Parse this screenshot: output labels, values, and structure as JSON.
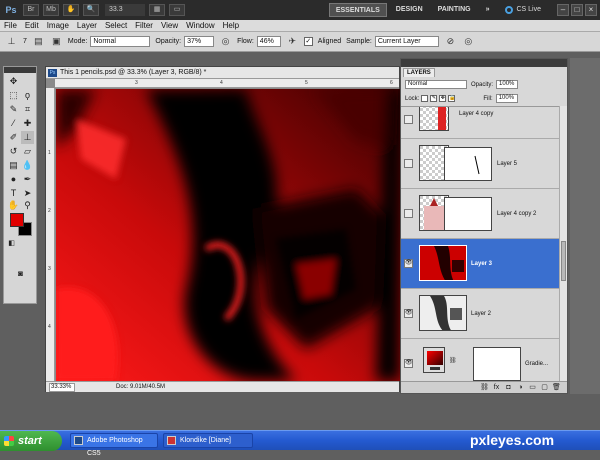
{
  "appbar": {
    "logo": "Ps",
    "zoom": "33.3",
    "workspaces": [
      "ESSENTIALS",
      "DESIGN",
      "PAINTING"
    ],
    "cslive": "CS Live"
  },
  "menu": [
    "File",
    "Edit",
    "Image",
    "Layer",
    "Select",
    "Filter",
    "View",
    "Window",
    "Help"
  ],
  "options": {
    "brush_size": "7",
    "mode_label": "Mode:",
    "mode_value": "Normal",
    "opacity_label": "Opacity:",
    "opacity_value": "37%",
    "flow_label": "Flow:",
    "flow_value": "46%",
    "aligned_label": "Aligned",
    "sample_label": "Sample:",
    "sample_value": "Current Layer"
  },
  "tools": {
    "foreground_color": "#e00000",
    "background_color": "#000000"
  },
  "document": {
    "title": "This 1 pencils.psd @ 33.3% (Layer 3, RGB/8) *",
    "zoom": "33.33%",
    "doc_size": "Doc: 9.01M/40.5M",
    "ruler_top": [
      "3",
      "4",
      "5",
      "6"
    ],
    "ruler_left": [
      "1",
      "2",
      "3",
      "4"
    ]
  },
  "layers_panel": {
    "tab": "LAYERS",
    "blend_mode": "Normal",
    "opacity_label": "Opacity:",
    "opacity_value": "100%",
    "lock_label": "Lock:",
    "fill_label": "Fill:",
    "fill_value": "100%",
    "layers": [
      {
        "name": "Layer 4 copy",
        "selected": false
      },
      {
        "name": "Layer 5",
        "selected": false
      },
      {
        "name": "Layer 4 copy 2",
        "selected": false
      },
      {
        "name": "Layer 3",
        "selected": true
      },
      {
        "name": "Layer 2",
        "selected": false
      },
      {
        "name": "Gradie...",
        "selected": false
      }
    ]
  },
  "taskbar": {
    "start": "start",
    "items": [
      "Adobe Photoshop CS5",
      "Klondike [Diane]"
    ]
  },
  "watermark": "pxleyes.com"
}
